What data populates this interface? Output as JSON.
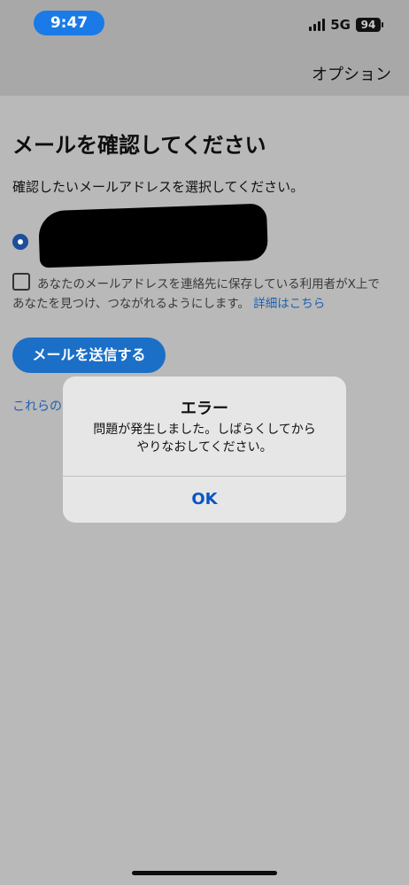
{
  "status_bar": {
    "time": "9:47",
    "network": "5G",
    "battery": "94",
    "icons": [
      "signal-icon",
      "battery-icon"
    ]
  },
  "header": {
    "options_label": "オプション"
  },
  "main": {
    "title": "メールを確認してください",
    "subtitle": "確認したいメールアドレスを選択してください。",
    "consent_text": "あなたのメールアドレスを連絡先に保存している利用者がX上であなたを見つけ、つながれるようにします。",
    "consent_link": "詳細はこちら",
    "send_button": "メールを送信する",
    "other_link": "これらの"
  },
  "alert": {
    "title": "エラー",
    "message_line1": "問題が発生しました。しばらくしてから",
    "message_line2": "やりなおしてください。",
    "ok_label": "OK"
  },
  "colors": {
    "accent": "#1b6fc7",
    "time_pill": "#1a7ae8",
    "link": "#1e60b3"
  }
}
